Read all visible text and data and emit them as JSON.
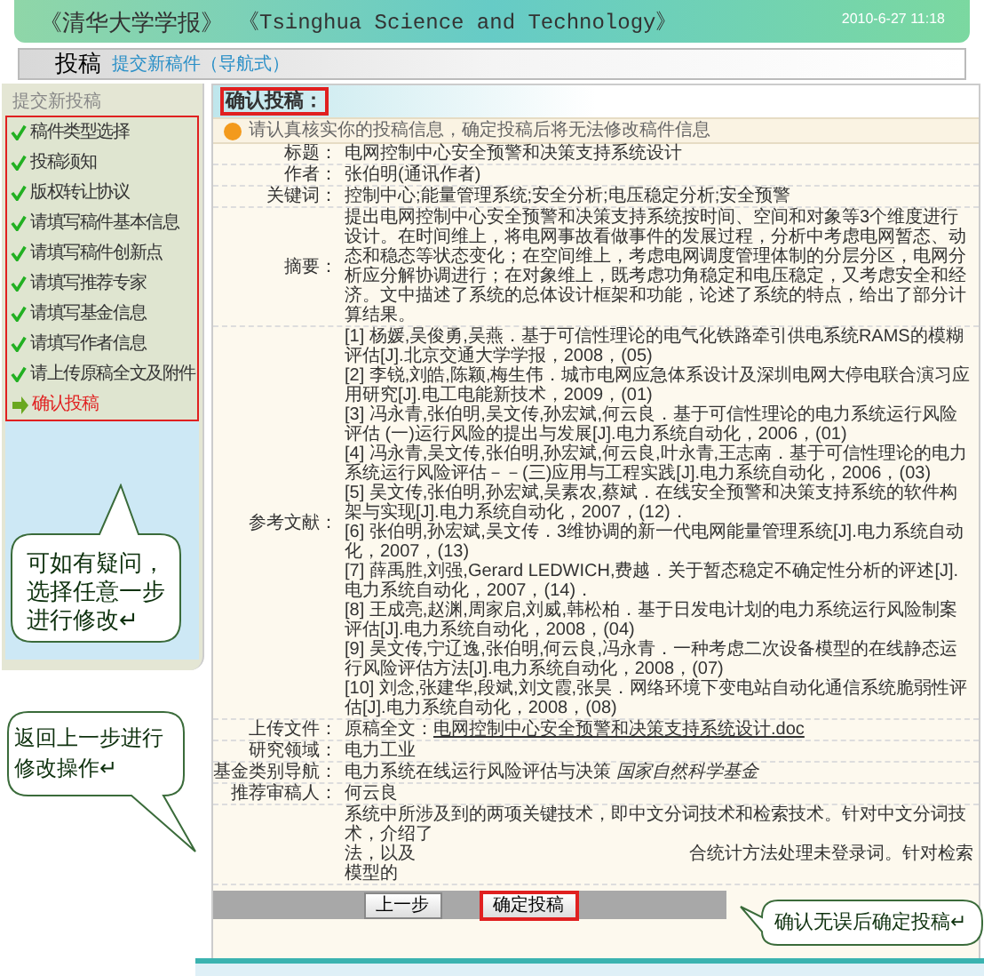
{
  "header": {
    "title": "《清华大学学报》",
    "subtitle": "《Tsinghua Science and Technology》",
    "datetime": "2010-6-27 11:18"
  },
  "nav": {
    "title": "投稿",
    "link": "提交新稿件（导航式）"
  },
  "sidebar": {
    "title": "提交新投稿",
    "steps": [
      {
        "label": "稿件类型选择",
        "kind": "done"
      },
      {
        "label": "投稿须知",
        "kind": "done"
      },
      {
        "label": "版权转让协议",
        "kind": "done"
      },
      {
        "label": "请填写稿件基本信息",
        "kind": "done"
      },
      {
        "label": "请填写稿件创新点",
        "kind": "done"
      },
      {
        "label": "请填写推荐专家",
        "kind": "done"
      },
      {
        "label": "请填写基金信息",
        "kind": "done"
      },
      {
        "label": "请填写作者信息",
        "kind": "done"
      },
      {
        "label": "请上传原稿全文及附件",
        "kind": "done"
      },
      {
        "label": "确认投稿",
        "kind": "current"
      }
    ]
  },
  "main": {
    "title": "确认投稿：",
    "notice": "请认真核实你的投稿信息，确定投稿后将无法修改稿件信息",
    "fields": [
      {
        "kind": "text",
        "label": "标题：",
        "value": "电网控制中心安全预警和决策支持系统设计"
      },
      {
        "kind": "text",
        "label": "作者：",
        "value": "张伯明(通讯作者)"
      },
      {
        "kind": "text",
        "label": "关键词：",
        "value": "控制中心;能量管理系统;安全分析;电压稳定分析;安全预警"
      },
      {
        "kind": "text",
        "label": "摘要：",
        "value": "提出电网控制中心安全预警和决策支持系统按时间、空间和对象等3个维度进行设计。在时间维上，将电网事故看做事件的发展过程，分析中考虑电网暂态、动态和稳态等状态变化；在空间维上，考虑电网调度管理体制的分层分区，电网分析应分解协调进行；在对象维上，既考虑功角稳定和电压稳定，又考虑安全和经济。文中描述了系统的总体设计框架和功能，论述了系统的特点，给出了部分计算结果。"
      },
      {
        "kind": "list",
        "label": "参考文献：",
        "items": [
          "[1] 杨媛,吴俊勇,吴燕．基于可信性理论的电气化铁路牵引供电系统RAMS的模糊评估[J].北京交通大学学报，2008，(05)",
          "[2] 李锐,刘皓,陈颖,梅生伟．城市电网应急体系设计及深圳电网大停电联合演习应用研究[J].电工电能新技术，2009，(01)",
          "[3] 冯永青,张伯明,吴文传,孙宏斌,何云良．基于可信性理论的电力系统运行风险评估 (一)运行风险的提出与发展[J].电力系统自动化，2006，(01)",
          "[4] 冯永青,吴文传,张伯明,孙宏斌,何云良,叶永青,王志南．基于可信性理论的电力系统运行风险评估－－(三)应用与工程实践[J].电力系统自动化，2006，(03)",
          "[5] 吴文传,张伯明,孙宏斌,吴素农,蔡斌．在线安全预警和决策支持系统的软件构架与实现[J].电力系统自动化，2007，(12)．",
          "[6] 张伯明,孙宏斌,吴文传．3维协调的新一代电网能量管理系统[J].电力系统自动化，2007，(13)",
          "[7] 薛禹胜,刘强,Gerard LEDWICH,费越．关于暂态稳定不确定性分析的评述[J].电力系统自动化，2007，(14)．",
          "[8] 王成亮,赵渊,周家启,刘威,韩松柏．基于日发电计划的电力系统运行风险制案评估[J].电力系统自动化，2008，(04)",
          "[9] 吴文传,宁辽逸,张伯明,何云良,冯永青．一种考虑二次设备模型的在线静态运行风险评估方法[J].电力系统自动化，2008，(07)",
          "[10] 刘念,张建华,段斌,刘文霞,张昊．网络环境下变电站自动化通信系统脆弱性评估[J].电力系统自动化，2008，(08)"
        ]
      },
      {
        "kind": "file",
        "label": "上传文件：",
        "prefix": "原稿全文：",
        "link": "电网控制中心安全预警和决策支持系统设计.doc"
      },
      {
        "kind": "text",
        "label": "研究领域：",
        "value": "电力工业"
      },
      {
        "kind": "text",
        "label": "基金类别导航：",
        "value": "电力系统在线运行风险评估与决策 *国家自然科学基金*"
      },
      {
        "kind": "text",
        "label": "推荐审稿人：",
        "value": "何云良"
      },
      {
        "kind": "fragments",
        "lines": [
          [
            "系统中所涉及到的两项关键技术，即中文分词技术和检索技术。针对中文分词技术，介绍了"
          ],
          [
            "法，以及",
            "合统计方法处理未登录词。针对检索"
          ],
          [
            "模型的"
          ]
        ]
      }
    ]
  },
  "buttons": [
    {
      "label": "上一步",
      "selected": false
    },
    {
      "label": "确定投稿",
      "selected": true
    }
  ],
  "callouts": [
    "可如有疑问，选择任意一步进行修改↵",
    "返回上一步进行修改操作↵",
    "确认无误后确定投稿↵"
  ]
}
